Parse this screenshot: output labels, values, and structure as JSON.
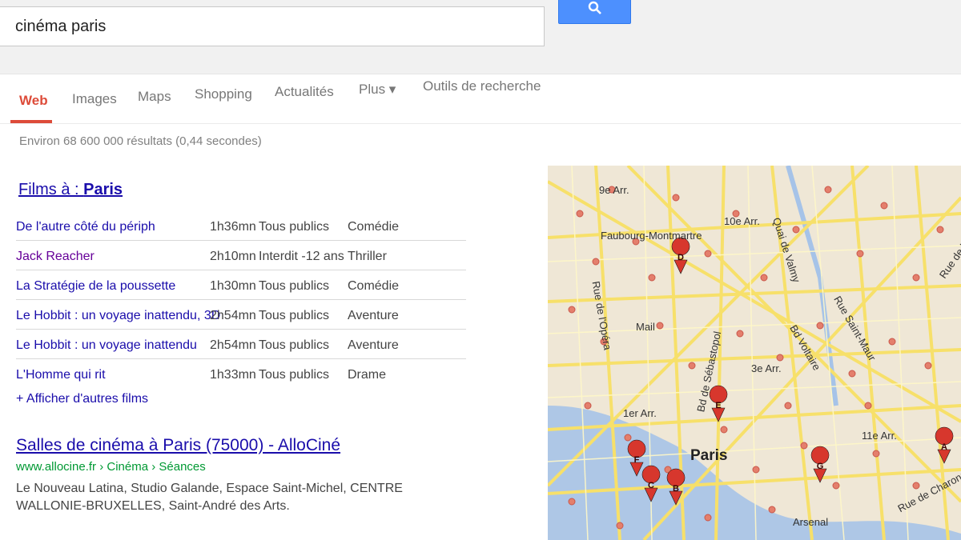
{
  "search": {
    "query": "cinéma paris"
  },
  "tabs": [
    {
      "label": "Web",
      "active": true
    },
    {
      "label": "Images"
    },
    {
      "label": "Maps"
    },
    {
      "label": "Shopping"
    },
    {
      "label": "Actualités"
    },
    {
      "label": "Plus ▾"
    },
    {
      "label": "Outils de recherche"
    }
  ],
  "stats": "Environ 68 600 000 résultats (0,44 secondes)",
  "films": {
    "title_prefix": "Films à : ",
    "title_city": "Paris",
    "rows": [
      {
        "name": "De l'autre côté du périph",
        "duration": "1h36mn",
        "rating": "Tous publics",
        "genre": "Comédie"
      },
      {
        "name": "Jack Reacher",
        "duration": "2h10mn",
        "rating": "Interdit -12 ans",
        "genre": "Thriller"
      },
      {
        "name": "La Stratégie de la poussette",
        "duration": "1h30mn",
        "rating": "Tous publics",
        "genre": "Comédie"
      },
      {
        "name": "Le Hobbit : un voyage inattendu, 3D",
        "duration": "2h54mn",
        "rating": "Tous publics",
        "genre": "Aventure"
      },
      {
        "name": "Le Hobbit : un voyage inattendu",
        "duration": "2h54mn",
        "rating": "Tous publics",
        "genre": "Aventure"
      },
      {
        "name": "L'Homme qui rit",
        "duration": "1h33mn",
        "rating": "Tous publics",
        "genre": "Drame"
      }
    ],
    "more_link": "+ Afficher d'autres films"
  },
  "result": {
    "title": "Salles de cinéma à Paris (75000) - AlloCiné",
    "url": "www.allocine.fr › Cinéma › Séances",
    "snippet": "Le Nouveau Latina, Studio Galande, Espace Saint-Michel, CENTRE WALLONIE-BRUXELLES, Saint-André des Arts."
  },
  "map": {
    "labels": [
      "9e Arr.",
      "10e Arr.",
      "Faubourg-Montmartre",
      "Mail",
      "3e Arr.",
      "1er Arr.",
      "11e Arr.",
      "Paris",
      "Arsenal",
      "Rue de Charonne",
      "Rue Saint-Maur",
      "Bd Voltaire",
      "Rue de l'Opéra",
      "Bd de Sébastopol",
      "Quai de Valmy",
      "Rue de la Roquette"
    ],
    "markers": [
      "A",
      "B",
      "C",
      "D",
      "E",
      "F",
      "G"
    ],
    "colors": {
      "marker": "#d7372d",
      "street": "#f7e06a",
      "water": "#a6c3e8",
      "background": "#efe7d6",
      "dot": "#e47f6c"
    }
  }
}
